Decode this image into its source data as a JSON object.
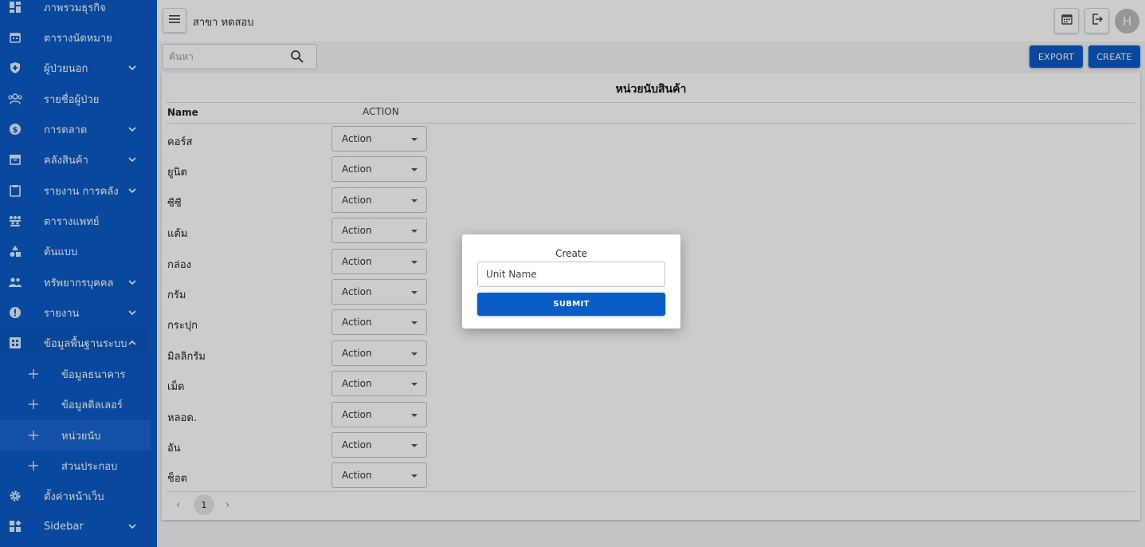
{
  "sidebar": {
    "items": [
      {
        "label": "ภาพรวมธุรกิจ",
        "icon": "dashboard-icon",
        "chevron": ""
      },
      {
        "label": "ตารางนัดหมาย",
        "icon": "calendar-icon",
        "chevron": ""
      },
      {
        "label": "ผู้ป่วยนอก",
        "icon": "shield-icon",
        "chevron": "down"
      },
      {
        "label": "รายชื่อผู้ป่วย",
        "icon": "people-icon",
        "chevron": ""
      },
      {
        "label": "การตลาด",
        "icon": "dollar-icon",
        "chevron": "down"
      },
      {
        "label": "คลังสินค้า",
        "icon": "archive-icon",
        "chevron": "down"
      },
      {
        "label": "รายงาน การคลัง",
        "icon": "clipboard-icon",
        "chevron": "down"
      },
      {
        "label": "ตารางแพทย์",
        "icon": "group-icon",
        "chevron": ""
      },
      {
        "label": "ต้นแบบ",
        "icon": "shapes-icon",
        "chevron": ""
      },
      {
        "label": "ทรัพยากรบุคคล",
        "icon": "people-icon",
        "chevron": "down"
      },
      {
        "label": "รายงาน",
        "icon": "alert-icon",
        "chevron": "down"
      },
      {
        "label": "ข้อมูลพื้นฐานระบบ",
        "icon": "grid-icon",
        "chevron": "up"
      }
    ],
    "sub_items": [
      {
        "label": "ข้อมูลธนาคาร"
      },
      {
        "label": "ข้อมูลดิลเลอร์"
      },
      {
        "label": "หน่วยนับ"
      },
      {
        "label": "ส่วนประกอบ"
      }
    ],
    "bottom_items": [
      {
        "label": "ตั้งค่าหน้าเว็บ",
        "icon": "gear-icon",
        "chevron": ""
      },
      {
        "label": "Sidebar",
        "icon": "widgets-icon",
        "chevron": "down"
      }
    ]
  },
  "topbar": {
    "branch": "สาขา ทดสอบ",
    "avatar_letter": "H"
  },
  "search": {
    "placeholder": "ค้นหา"
  },
  "buttons": {
    "export": "EXPORT",
    "create": "CREATE"
  },
  "table": {
    "title": "หน่วยนับสินค้า",
    "col_name": "Name",
    "col_action": "ACTION",
    "action_label": "Action",
    "rows": [
      "คอร์ส",
      "ยูนิต",
      "ซีซี",
      "แต้ม",
      "กล่อง",
      "กรัม",
      "กระปุก",
      "มิลลิกรัม",
      "เม็ด",
      "หลอด.",
      "อัน",
      "ช็อต"
    ]
  },
  "pagination": {
    "current": "1"
  },
  "modal": {
    "title": "Create",
    "input_placeholder": "Unit Name",
    "submit": "SUBMIT"
  },
  "colors": {
    "primary": "#0a5cc7",
    "overlay": "rgba(0,0,0,0.2)"
  }
}
